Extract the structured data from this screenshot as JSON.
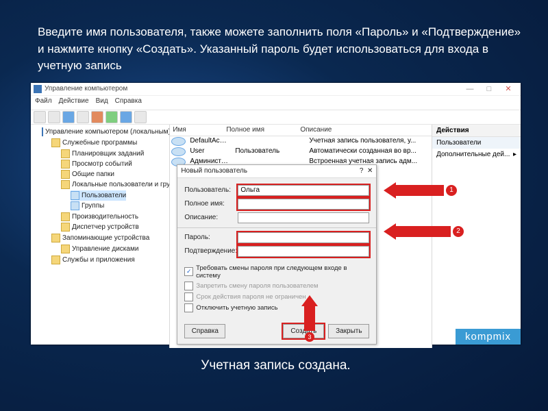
{
  "instruction": "Введите имя пользователя, также можете заполнить поля «Пароль» и «Подтверждение» и нажмите кнопку «Создать». Указанный пароль будет использоваться для входа в учетную запись",
  "caption": "Учетная запись создана.",
  "watermark": "kompmix",
  "window": {
    "title": "Управление компьютером",
    "menu": [
      "Файл",
      "Действие",
      "Вид",
      "Справка"
    ]
  },
  "tree": {
    "root": "Управление компьютером (локальным)",
    "items": [
      "Служебные программы",
      "Планировщик заданий",
      "Просмотр событий",
      "Общие папки",
      "Локальные пользователи и группы",
      "Пользователи",
      "Группы",
      "Производительность",
      "Диспетчер устройств",
      "Запоминающие устройства",
      "Управление дисками",
      "Службы и приложения"
    ]
  },
  "list": {
    "cols": [
      "Имя",
      "Полное имя",
      "Описание"
    ],
    "rows": [
      {
        "name": "DefaultAcco...",
        "full": "",
        "desc": "Учетная запись пользователя, у..."
      },
      {
        "name": "User",
        "full": "Пользователь",
        "desc": "Автоматически созданная во вр..."
      },
      {
        "name": "Администо...",
        "full": "",
        "desc": "Встроенная учетная запись адм..."
      }
    ]
  },
  "dialog": {
    "title": "Новый пользователь",
    "fields": {
      "user": "Пользователь:",
      "full": "Полное имя:",
      "desc": "Описание:",
      "pass": "Пароль:",
      "conf": "Подтверждение:"
    },
    "values": {
      "user": "Ольга"
    },
    "checks": [
      "Требовать смены пароля при следующем входе в систему",
      "Запретить смену пароля пользователем",
      "Срок действия пароля не ограничен",
      "Отключить учетную запись"
    ],
    "buttons": {
      "help": "Справка",
      "create": "Создать",
      "close": "Закрыть"
    }
  },
  "actions": {
    "header": "Действия",
    "group": "Пользователи",
    "more": "Дополнительные дей..."
  },
  "annotations": [
    "1",
    "2",
    "3"
  ]
}
